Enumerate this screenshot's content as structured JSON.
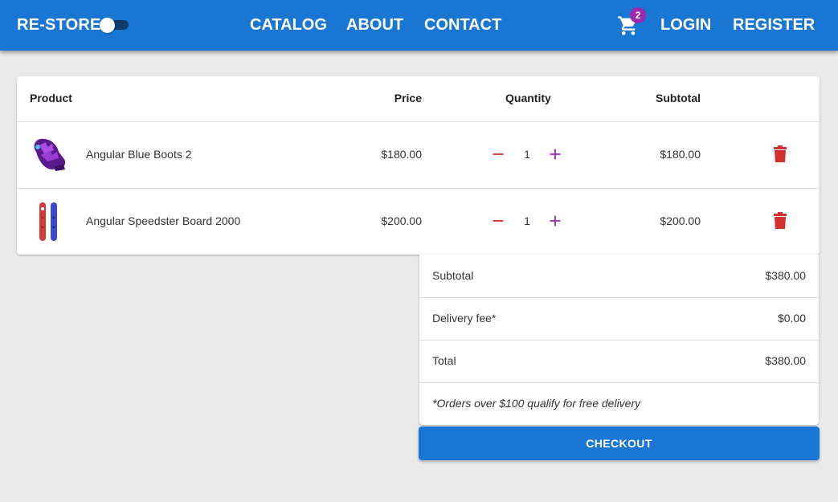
{
  "header": {
    "brand": "RE-STORE",
    "nav": [
      "CATALOG",
      "ABOUT",
      "CONTACT"
    ],
    "cart_count": "2",
    "login": "LOGIN",
    "register": "REGISTER"
  },
  "basket": {
    "columns": {
      "product": "Product",
      "price": "Price",
      "quantity": "Quantity",
      "subtotal": "Subtotal"
    },
    "items": [
      {
        "name": "Angular Blue Boots 2",
        "price": "$180.00",
        "quantity": "1",
        "subtotal": "$180.00",
        "icon": "mitten-product-icon"
      },
      {
        "name": "Angular Speedster Board 2000",
        "price": "$200.00",
        "quantity": "1",
        "subtotal": "$200.00",
        "icon": "snowboard-product-icon"
      }
    ]
  },
  "summary": {
    "subtotal_label": "Subtotal",
    "subtotal_value": "$380.00",
    "delivery_label": "Delivery fee*",
    "delivery_value": "$0.00",
    "total_label": "Total",
    "total_value": "$380.00",
    "note": "*Orders over $100 qualify for free delivery"
  },
  "checkout_label": "CHECKOUT",
  "colors": {
    "primary": "#1976d2",
    "badge": "#9c27b0",
    "remove": "#e53935",
    "increment": "#9c27b0",
    "decrement": "#d32f2f"
  }
}
